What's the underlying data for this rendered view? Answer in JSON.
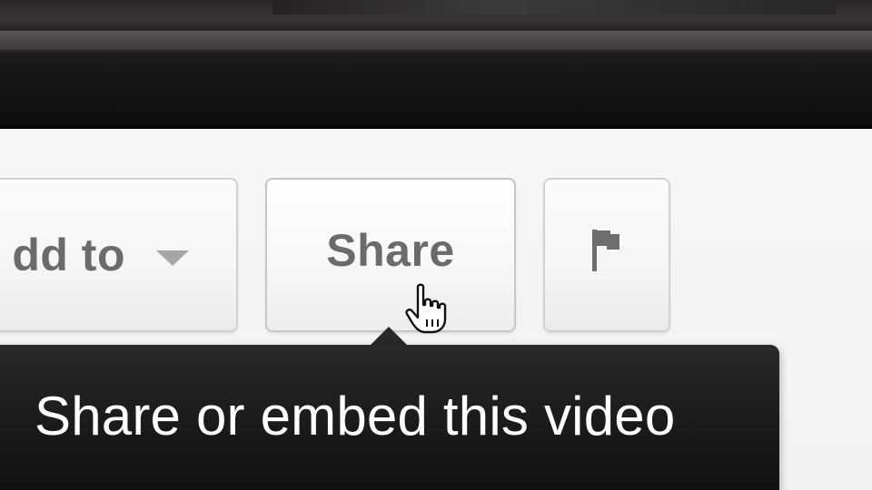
{
  "action_bar": {
    "add_to_label": "dd to",
    "share_label": "Share",
    "flag_icon": "flag-icon",
    "dropdown_icon": "chevron-down-icon"
  },
  "tooltip": {
    "text": "Share or embed this video"
  },
  "cursor": {
    "icon": "hand-pointer-icon"
  },
  "colors": {
    "button_text": "#6b6b6b",
    "tooltip_bg": "#1c1b1b",
    "tooltip_text": "#ffffff",
    "page_bg": "#f4f4f2",
    "player_bar": "#141212"
  }
}
